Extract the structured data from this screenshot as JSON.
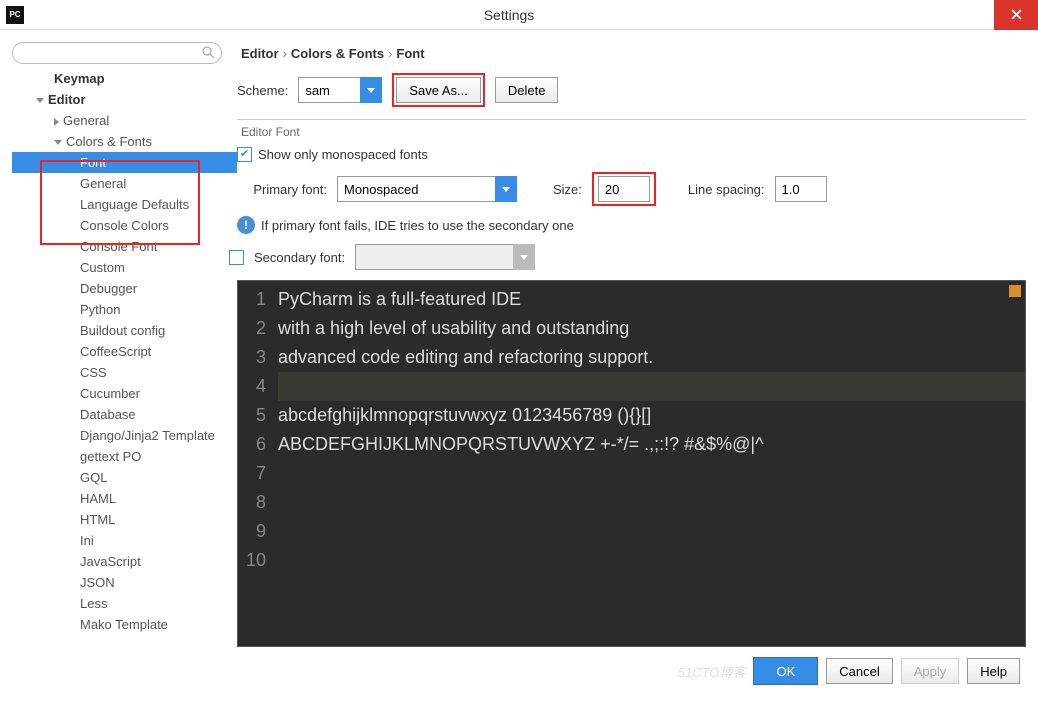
{
  "window": {
    "title": "Settings"
  },
  "tree": {
    "keymap": "Keymap",
    "editor": "Editor",
    "general": "General",
    "colors_fonts": "Colors & Fonts",
    "items": [
      "Font",
      "General",
      "Language Defaults",
      "Console Colors",
      "Console Font",
      "Custom",
      "Debugger",
      "Python",
      "Buildout config",
      "CoffeeScript",
      "CSS",
      "Cucumber",
      "Database",
      "Django/Jinja2 Template",
      "gettext PO",
      "GQL",
      "HAML",
      "HTML",
      "Ini",
      "JavaScript",
      "JSON",
      "Less",
      "Mako Template"
    ]
  },
  "breadcrumb": [
    "Editor",
    "Colors & Fonts",
    "Font"
  ],
  "scheme": {
    "label": "Scheme:",
    "value": "sam",
    "save_as": "Save As...",
    "delete": "Delete"
  },
  "editorfont": {
    "legend": "Editor Font",
    "show_mono": "Show only monospaced fonts",
    "primary_label": "Primary font:",
    "primary_value": "Monospaced",
    "size_label": "Size:",
    "size_value": "20",
    "linesp_label": "Line spacing:",
    "linesp_value": "1.0",
    "info": "If primary font fails, IDE tries to use the secondary one",
    "secondary_label": "Secondary font:",
    "secondary_value": ""
  },
  "preview": {
    "lines": [
      "PyCharm is a full-featured IDE",
      "with a high level of usability and outstanding",
      "advanced code editing and refactoring support.",
      "",
      "abcdefghijklmnopqrstuvwxyz 0123456789 (){}[]",
      "ABCDEFGHIJKLMNOPQRSTUVWXYZ +-*/= .,;:!? #&$%@|^",
      "",
      "",
      "",
      ""
    ],
    "hl_index": 3
  },
  "footer": {
    "ok": "OK",
    "cancel": "Cancel",
    "apply": "Apply",
    "help": "Help",
    "watermark": "51CTO博客"
  }
}
